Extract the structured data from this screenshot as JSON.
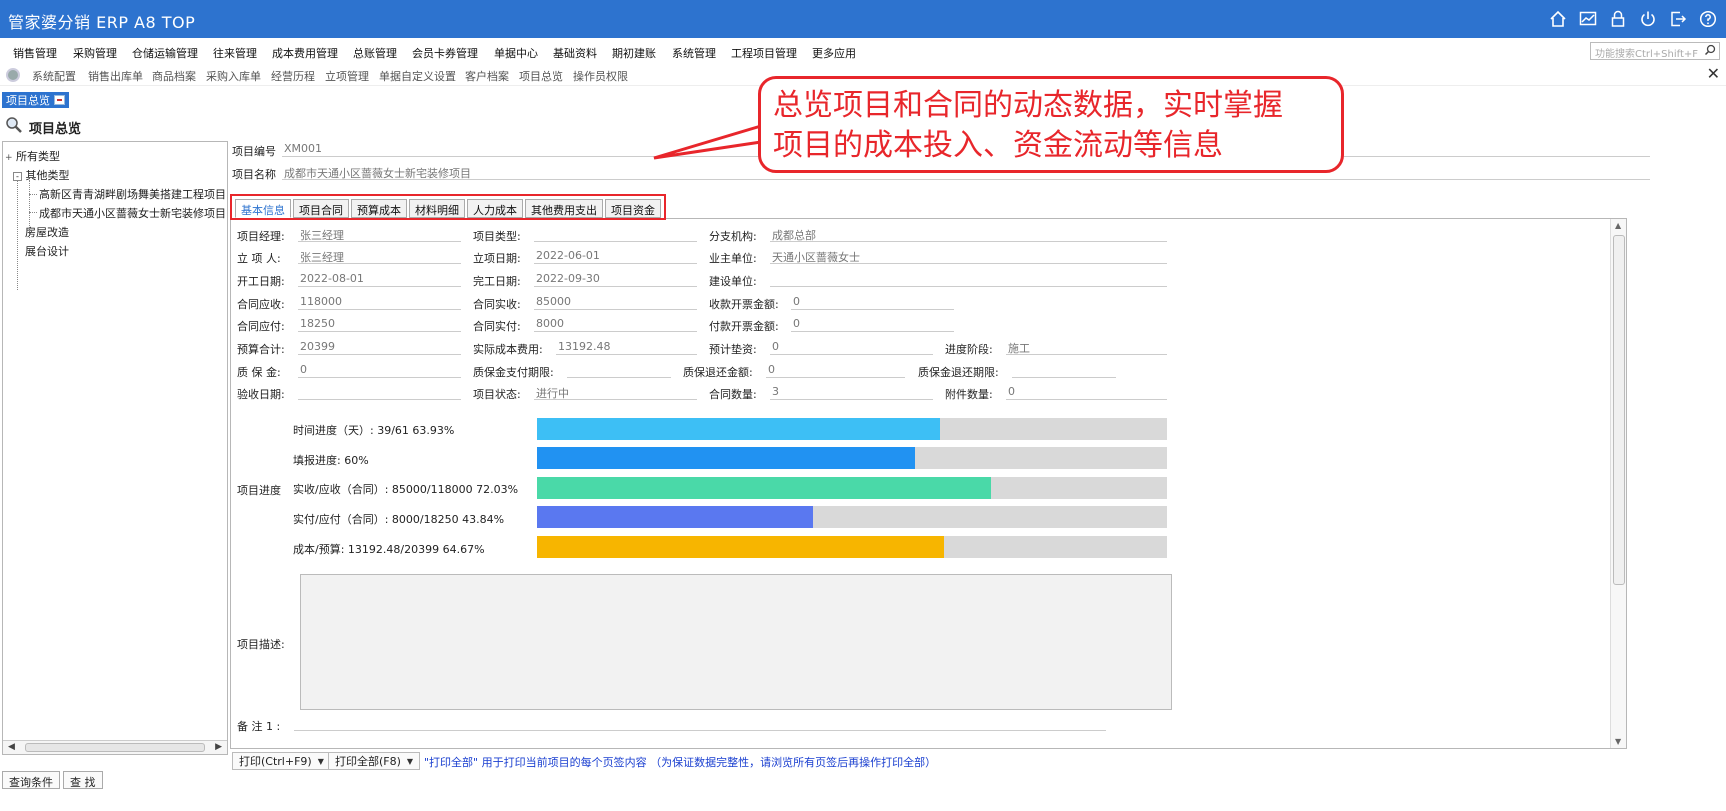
{
  "app": {
    "title": "管家婆分销 ERP A8 TOP"
  },
  "menu": [
    "销售管理",
    "采购管理",
    "仓储运输管理",
    "往来管理",
    "成本费用管理",
    "总账管理",
    "会员卡券管理",
    "单据中心",
    "基础资料",
    "期初建账",
    "系统管理",
    "工程项目管理",
    "更多应用"
  ],
  "search": {
    "placeholder": "功能搜索Ctrl+Shift+F"
  },
  "quickbar": [
    "系统配置",
    "销售出库单",
    "商品档案",
    "采购入库单",
    "经营历程",
    "立项管理",
    "单据自定义设置",
    "客户档案",
    "项目总览",
    "操作员权限"
  ],
  "page_tab": "项目总览",
  "page_title": "项目总览",
  "tree": {
    "root": "所有类型",
    "group": "其他类型",
    "children": [
      "高新区青青湖畔剧场舞美搭建工程项目",
      "成都市天通小区蔷薇女士新宅装修项目"
    ],
    "others": [
      "房屋改造",
      "展台设计"
    ]
  },
  "header": {
    "code_label": "项目编号",
    "code": "XM001",
    "name_label": "项目名称",
    "name": "成都市天通小区蔷薇女士新宅装修项目"
  },
  "tabs": [
    "基本信息",
    "项目合同",
    "预算成本",
    "材料明细",
    "人力成本",
    "其他费用支出",
    "项目资金"
  ],
  "fields": {
    "manager_label": "项目经理:",
    "manager": "张三经理",
    "type_label": "项目类型:",
    "type": "",
    "branch_label": "分支机构:",
    "branch": "成都总部",
    "creator_label": "立 项 人:",
    "creator": "张三经理",
    "setup_date_label": "立项日期:",
    "setup_date": "2022-06-01",
    "owner_label": "业主单位:",
    "owner": "天通小区蔷薇女士",
    "start_label": "开工日期:",
    "start": "2022-08-01",
    "finish_label": "完工日期:",
    "finish": "2022-09-30",
    "builder_label": "建设单位:",
    "builder": "",
    "receivable_label": "合同应收:",
    "receivable": "118000",
    "received_label": "合同实收:",
    "received": "85000",
    "rec_invoice_label": "收款开票金额:",
    "rec_invoice": "0",
    "payable_label": "合同应付:",
    "payable": "18250",
    "paid_label": "合同实付:",
    "paid": "8000",
    "pay_invoice_label": "付款开票金额:",
    "pay_invoice": "0",
    "budget_label": "预算合计:",
    "budget": "20399",
    "actual_cost_label": "实际成本费用:",
    "actual_cost": "13192.48",
    "advance_label": "预计垫资:",
    "advance": "0",
    "stage_label": "进度阶段:",
    "stage": "施工",
    "warranty_label": "质 保 金:",
    "warranty": "0",
    "warranty_term_label": "质保金支付期限:",
    "warranty_term": "",
    "warranty_return_label": "质保退还金额:",
    "warranty_return": "0",
    "warranty_return_term_label": "质保金退还期限:",
    "warranty_return_term": "",
    "accept_label": "验收日期:",
    "accept": "",
    "status_label": "项目状态:",
    "status": "进行中",
    "contracts_label": "合同数量:",
    "contracts": "3",
    "attachments_label": "附件数量:",
    "attachments": "0"
  },
  "progress": {
    "label": "项目进度",
    "bars": [
      {
        "text": "时间进度（天）: 39/61  63.93%",
        "percent": 63.93,
        "color": "#3dbff5"
      },
      {
        "text": "填报进度:    60%",
        "percent": 60,
        "color": "#2192f2"
      },
      {
        "text": "实收/应收（合同）: 85000/118000  72.03%",
        "percent": 72.03,
        "color": "#4ad9a8"
      },
      {
        "text": "实付/应付（合同）: 8000/18250  43.84%",
        "percent": 43.84,
        "color": "#5a78f0"
      },
      {
        "text": "成本/预算: 13192.48/20399  64.67%",
        "percent": 64.67,
        "color": "#f7b500"
      }
    ]
  },
  "desc_label": "项目描述:",
  "note_label": "备 注 1 :",
  "bottom": {
    "print": "打印(Ctrl+F9)",
    "print_all": "打印全部(F8)",
    "hint": "\"打印全部\" 用于打印当前项目的每个页签内容 （为保证数据完整性，请浏览所有页签后再操作打印全部）"
  },
  "query_buttons": [
    "查询条件",
    "查 找"
  ],
  "callout": {
    "line1": "总览项目和合同的动态数据，实时掌握",
    "line2": "项目的成本投入、资金流动等信息"
  },
  "colors": {
    "brand": "#2d73cf",
    "callout": "#e8262b",
    "hint": "#1a3fd0"
  }
}
